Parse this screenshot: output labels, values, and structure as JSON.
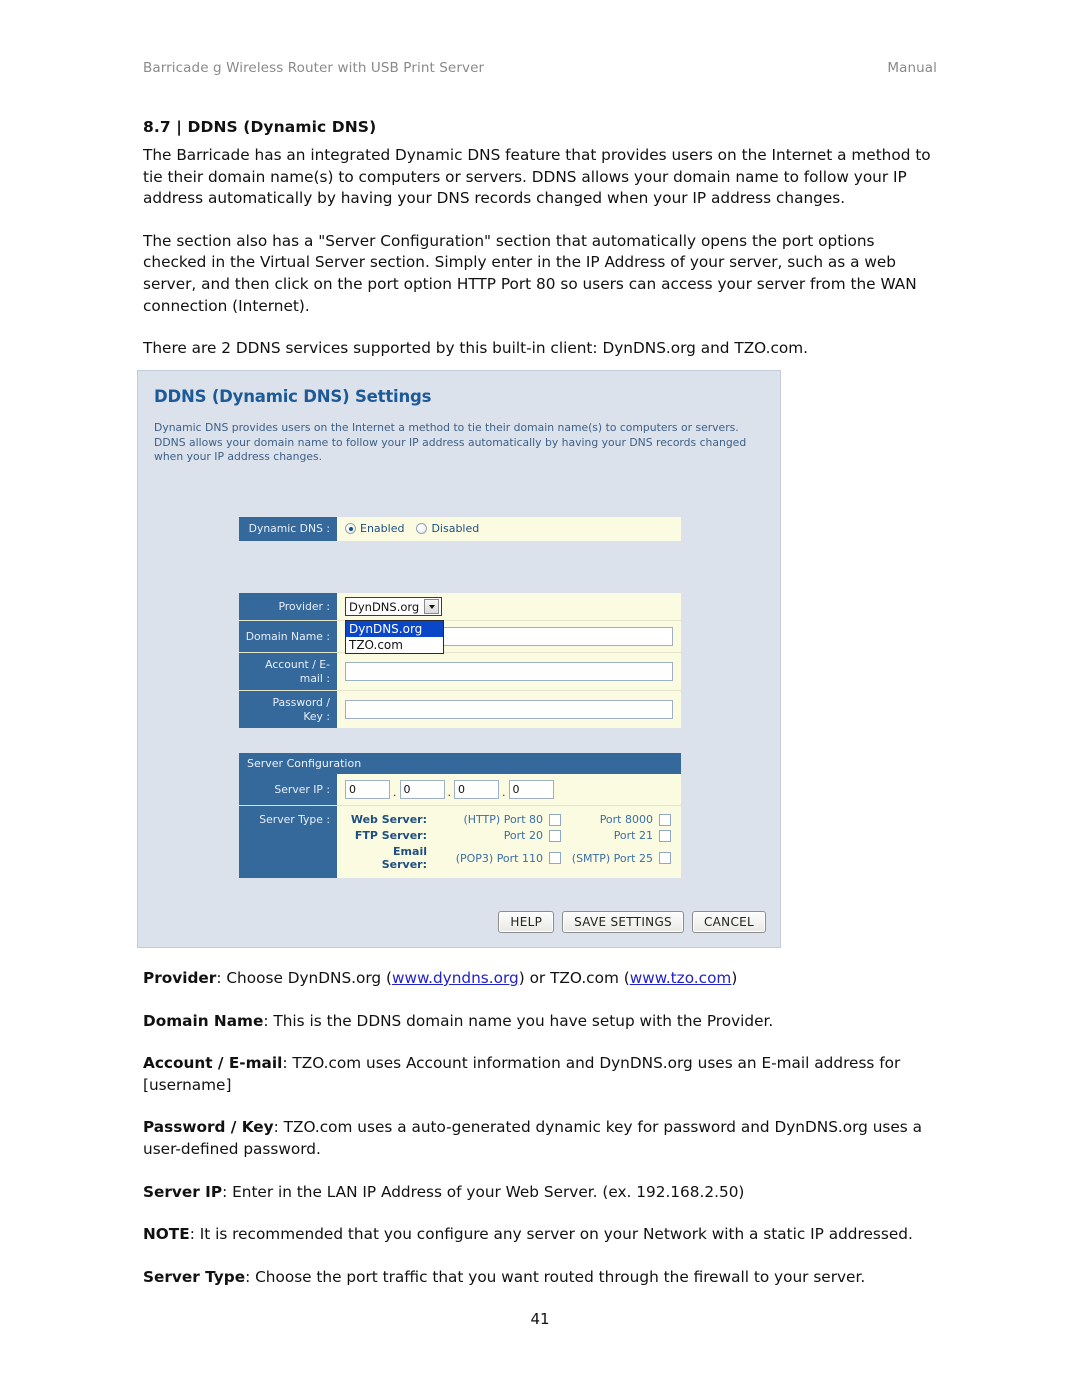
{
  "runhead": {
    "left": "Barricade g Wireless Router with USB Print Server",
    "right": "Manual"
  },
  "doc": {
    "section_title": "8.7 | DDNS (Dynamic DNS)",
    "paragraph1": "The Barricade has an integrated Dynamic DNS feature that provides users on the Internet a method to tie their domain name(s) to computers or servers. DDNS allows your domain name to follow your IP address automatically by having your DNS records changed when your IP address changes.",
    "paragraph2": "The section also has a \"Server Configuration\" section that automatically opens the port options checked in the Virtual Server section. Simply enter in the IP Address of your server, such as a web server, and then click on the port option HTTP Port 80 so users can access your server from the WAN connection (Internet).",
    "paragraph3": "There are 2 DDNS services supported by this built-in client: DynDNS.org and TZO.com.",
    "defs": {
      "provider_term": "Provider",
      "provider_text_a": ": Choose DynDNS.org (",
      "provider_link1": "www.dyndns.org",
      "provider_text_b": ") or TZO.com (",
      "provider_link2": "www.tzo.com",
      "provider_text_c": ")",
      "domain_term": "Domain Name",
      "domain_text": ": This is the DDNS domain name you have setup with the Provider.",
      "account_term": "Account / E-mail",
      "account_text": ": TZO.com uses Account information and DynDNS.org uses an E-mail address for [username]",
      "password_term": "Password / Key",
      "password_text": ": TZO.com uses a auto-generated dynamic key for password and DynDNS.org uses a user-defined password.",
      "serverip_term": "Server IP",
      "serverip_text": ": Enter in the LAN IP Address of your Web Server. (ex. 192.168.2.50)",
      "note_term": "NOTE",
      "note_text": ": It is recommended that you configure any server on your Network with a static IP addressed.",
      "servertype_term": "Server Type",
      "servertype_text": ": Choose the port traffic that you want routed through the firewall to your server."
    },
    "page_number": "41"
  },
  "screenshot": {
    "title": "DDNS (Dynamic DNS) Settings",
    "description": "Dynamic DNS provides users on the Internet a method to tie their domain name(s) to computers or servers. DDNS allows your domain name to follow your IP address automatically by having your DNS records changed when your IP address changes.",
    "dynamic_dns": {
      "label": "Dynamic DNS :",
      "enabled_label": "Enabled",
      "disabled_label": "Disabled",
      "selected": "Enabled"
    },
    "provider": {
      "label": "Provider :",
      "value": "DynDNS.org",
      "options": [
        "DynDNS.org",
        "TZO.com"
      ],
      "dropdown_open": true
    },
    "domain_name": {
      "label": "Domain Name :",
      "value": ""
    },
    "account_email": {
      "label": "Account / E-mail :",
      "label_line1": "Account / E-",
      "label_line2": "mail :",
      "value": ""
    },
    "password_key": {
      "label": "Password / Key :",
      "label_line1": "Password /",
      "label_line2": "Key :",
      "value": ""
    },
    "server_configuration": {
      "header": "Server Configuration",
      "server_ip": {
        "label": "Server IP :",
        "octets": [
          "0",
          "0",
          "0",
          "0"
        ],
        "separator": "."
      },
      "server_type": {
        "label": "Server Type :",
        "rows": [
          {
            "name": "Web Server:",
            "port_a": "(HTTP) Port 80",
            "checked_a": false,
            "port_b": "Port 8000",
            "checked_b": false
          },
          {
            "name": "FTP Server:",
            "port_a": "Port 20",
            "checked_a": false,
            "port_b": "Port 21",
            "checked_b": false
          },
          {
            "name": "Email Server:",
            "port_a": "(POP3) Port 110",
            "checked_a": false,
            "port_b": "(SMTP) Port 25",
            "checked_b": false
          }
        ]
      }
    },
    "buttons": {
      "help": "HELP",
      "save": "SAVE SETTINGS",
      "cancel": "CANCEL"
    },
    "colors": {
      "panel_bg": "#dbe2ec",
      "label_blue": "#35699c",
      "field_bg": "#fbfbe2",
      "title_blue": "#1e5a96",
      "highlight_blue": "#0a46c8",
      "link_blue": "#2222cc"
    }
  }
}
